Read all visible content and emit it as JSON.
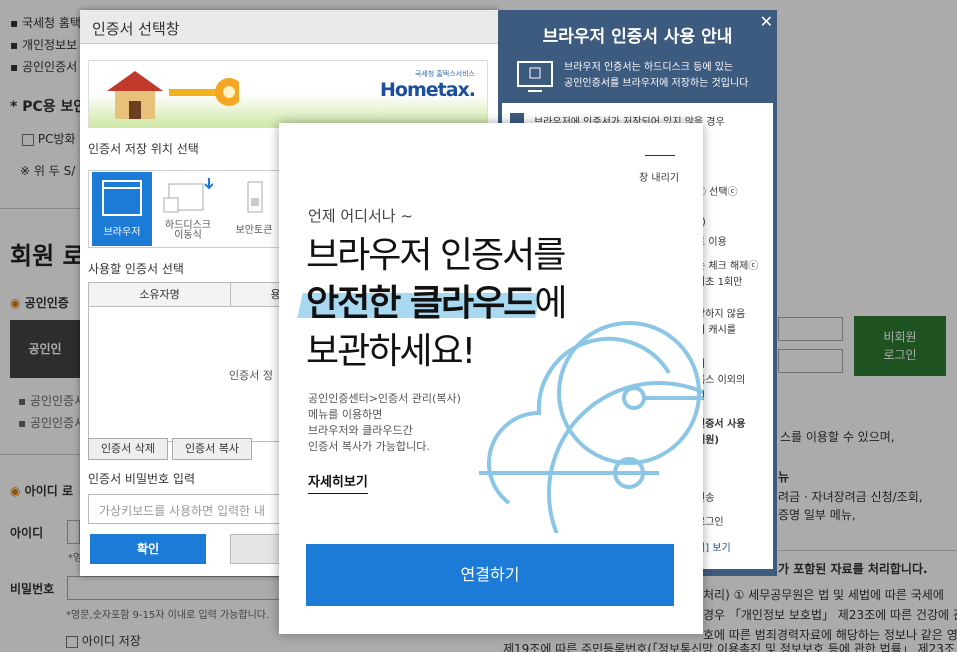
{
  "background": {
    "top_bullets": [
      "국세청 홈택",
      "개인정보보",
      "공인인증서"
    ],
    "pc_title": "PC용 보안",
    "pc_checkbox": "PC방화",
    "pc_note": "※ 위 두 S/",
    "member_title": "회원 로",
    "cert_section": "공인인증",
    "cert_button": "공인인",
    "cert_bullets": [
      "공인인증서",
      "공인인증서"
    ],
    "id_section": "아이디 로",
    "id_label": "아이디",
    "pw_label": "비밀번호",
    "pw_hint": "*영문,숫자포함 9-15자 이내로 입력 가능합니다.",
    "id_save": "아이디 저장",
    "nonmember_button": "비회원\n로그인",
    "right_text_1": "스를 이용할 수 있으며,",
    "right_text_2": "뉴",
    "right_text_3": "려금 · 자녀장려금 신청/조회,",
    "right_text_4": "증명 일부 메뉴,",
    "right_text_5": "가 포함된 자료를 처리합니다.",
    "right_text_6": "처리) ① 세무공무원은 법 및 세법에 따른 국세에",
    "right_text_7": "경우 「개인정보 보호법」 제23조에 따른 건강에 관",
    "right_text_8": "호에 따른 범죄경력자료에 해당하는 정보나 같은 영",
    "right_text_9": "제19조에 따른 주민등록번호(「정보통신망 이용촉진 및 정보보호 등에 관한 법률」 제23조"
  },
  "cert_dialog": {
    "title": "인증서 선택창",
    "banner_logo": "Hometax.",
    "banner_logo_sub": "국세청 홈택스서비스",
    "location_label": "인증서 저장 위치 선택",
    "locations": [
      "브라우저",
      "하드디스크\n이동식",
      "보안토큰"
    ],
    "select_label": "사용할 인증서 선택",
    "col_owner": "소유자명",
    "col_usage": "용",
    "empty_text": "인증서 정",
    "delete_button": "인증서 삭제",
    "copy_button": "인증서 복사",
    "password_label": "인증서 비밀번호 입력",
    "password_placeholder": "가상키보드를 사용하면 입력한 내",
    "ok_button": "확인"
  },
  "guide": {
    "title": "브라우저 인증서 사용 안내",
    "close": "✕",
    "desc": "브라우저 인증서는 하드디스크 등에 있는\n공인인증서를 브라우저에 저장하는 것입니다",
    "panel_top": "브라우저에 인증서가 저장되어 있지 않을 경우",
    "items": [
      "ⓒ 선택ⓒ",
      "y)",
      "트 이용",
      "는 체크 해제ⓒ",
      "최초 1회만",
      "장하지 않음",
      "저 캐시를",
      "기",
      "록스 이외의",
      "원",
      "인증서 사용",
      "해원)",
      "전송",
      "로그인",
      "됨] 보기"
    ]
  },
  "cloud_modal": {
    "close_label": "창 내리기",
    "subtitle": "언제 어디서나 ~",
    "headline_1": "브라우저 인증서를",
    "headline_2_bold": "안전한 클라우드",
    "headline_2_rest": "에",
    "headline_3": "보관하세요!",
    "body": "공인인증센터>인증서 관리(복사)\n메뉴를 이용하면\n브라우저와 클라우드간\n인증서 복사가 가능합니다.",
    "detail_link": "자세히보기",
    "connect_button": "연결하기"
  },
  "colors": {
    "accent": "#1b7bd6",
    "guide_bg": "#3d5a7f",
    "cloud": "#8cc6e6",
    "nonmember": "#2e7d32"
  }
}
